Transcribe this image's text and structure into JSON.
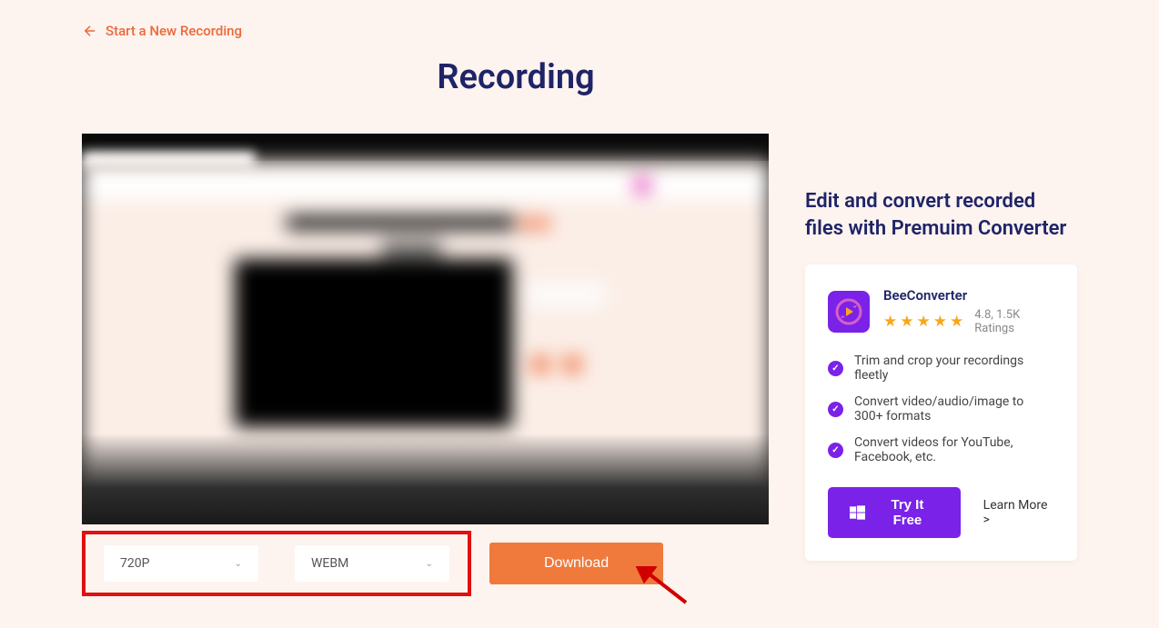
{
  "nav": {
    "back_label": "Start a New Recording"
  },
  "page_title": "Recording",
  "controls": {
    "resolution": "720P",
    "format": "WEBM",
    "download_label": "Download"
  },
  "promo": {
    "title": "Edit and convert recorded files with Premuim Converter",
    "product_name": "BeeConverter",
    "rating_text": "4.8, 1.5K Ratings",
    "features": [
      "Trim and crop your recordings fleetly",
      "Convert video/audio/image to 300+ formats",
      "Convert videos for YouTube, Facebook, etc."
    ],
    "try_label": "Try It Free",
    "learn_more_label": "Learn More >"
  }
}
